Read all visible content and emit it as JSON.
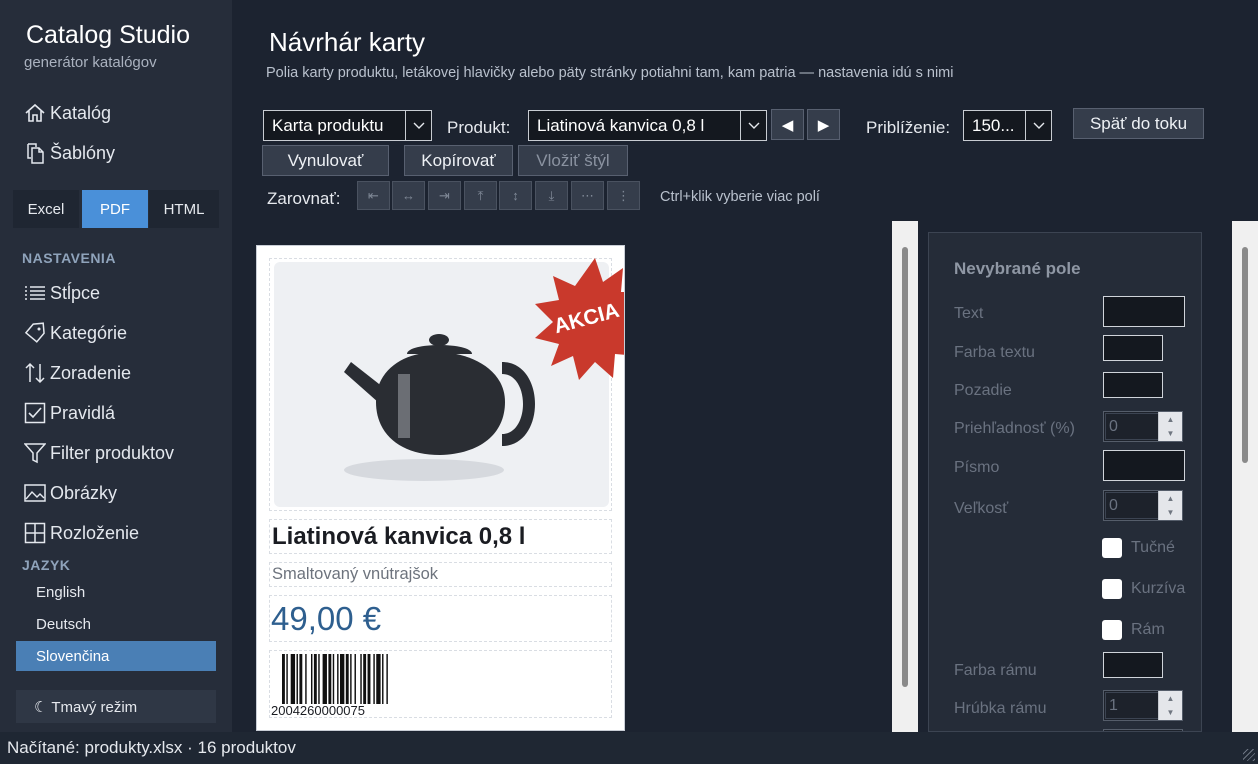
{
  "app": {
    "title": "Catalog Studio",
    "subtitle": "generátor katalógov"
  },
  "sidebar": {
    "nav": [
      {
        "label": "Katalóg",
        "icon": "home-icon"
      },
      {
        "label": "Šablóny",
        "icon": "copy-icon"
      }
    ],
    "formats": [
      {
        "label": "Excel",
        "active": false
      },
      {
        "label": "PDF",
        "active": true
      },
      {
        "label": "HTML",
        "active": false
      }
    ],
    "settings_heading": "NASTAVENIA",
    "settings": [
      {
        "label": "Stĺpce",
        "icon": "list-icon"
      },
      {
        "label": "Kategórie",
        "icon": "tag-icon"
      },
      {
        "label": "Zoradenie",
        "icon": "sort-icon"
      },
      {
        "label": "Pravidlá",
        "icon": "checkbox-icon"
      },
      {
        "label": "Filter produktov",
        "icon": "filter-icon"
      },
      {
        "label": "Obrázky",
        "icon": "image-icon"
      },
      {
        "label": "Rozloženie",
        "icon": "grid-icon"
      }
    ],
    "language_heading": "JAZYK",
    "languages": [
      {
        "label": "English",
        "active": false
      },
      {
        "label": "Deutsch",
        "active": false
      },
      {
        "label": "Slovenčina",
        "active": true
      }
    ],
    "dark_mode": "☾  Tmavý režim"
  },
  "header": {
    "title": "Návrhár karty",
    "description": "Polia karty produktu, letákovej hlavičky alebo päty stránky potiahni tam, kam patria — nastavenia idú s nimi"
  },
  "toolbar": {
    "template_select": "Karta produktu",
    "product_label": "Produkt:",
    "product_select": "Liatinová kanvica 0,8 l",
    "prev": "◀",
    "next": "▶",
    "zoom_label": "Priblíženie:",
    "zoom_select": "150...",
    "back_button": "Späť do toku",
    "reset_button": "Vynulovať",
    "copy_button": "Kopírovať",
    "paste_button": "Vložiť štýl",
    "align_label": "Zarovnať:",
    "align_buttons": [
      "⇤",
      "↔",
      "⇥",
      "⤒",
      "↕",
      "⤓",
      "⋯",
      "⋮"
    ],
    "align_hint": "Ctrl+klik vyberie viac polí"
  },
  "card": {
    "badge": "AKCIA",
    "title": "Liatinová kanvica 0,8 l",
    "subtitle": "Smaltovaný vnútrajšok",
    "price": "49,00 €",
    "ean": "2004260000075",
    "colors": {
      "badge": "#c9392c",
      "price": "#2e5f8f",
      "kettle": "#2a2d33"
    }
  },
  "properties": {
    "title": "Nevybrané pole",
    "text_label": "Text",
    "text_color_label": "Farba textu",
    "background_label": "Pozadie",
    "opacity_label": "Priehľadnosť (%)",
    "opacity_value": "0",
    "font_label": "Písmo",
    "size_label": "Veľkosť",
    "size_value": "0",
    "bold_label": "Tučné",
    "italic_label": "Kurzíva",
    "frame_label": "Rám",
    "frame_color_label": "Farba rámu",
    "frame_width_label": "Hrúbka rámu",
    "frame_width_value": "1"
  },
  "status": {
    "text": "Načítané: produkty.xlsx · 16 produktov"
  }
}
